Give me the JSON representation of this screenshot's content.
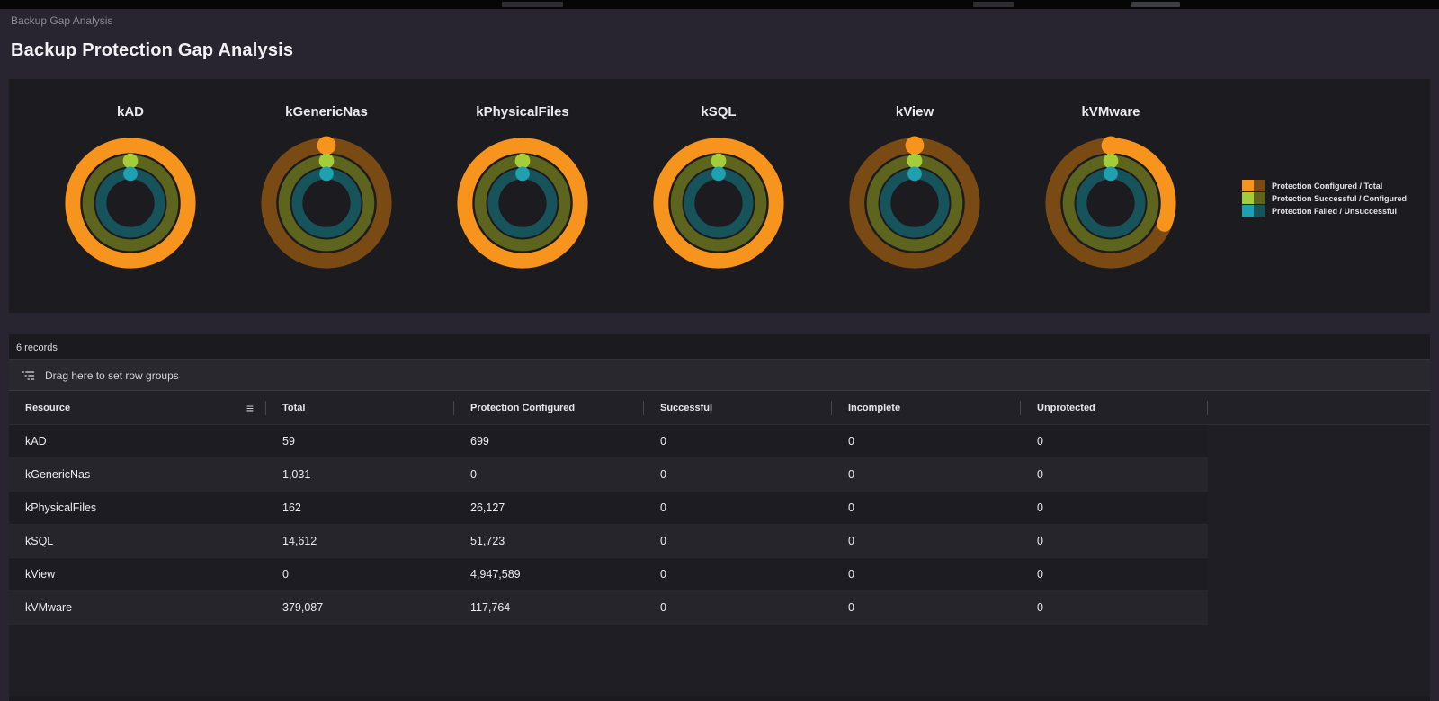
{
  "breadcrumb": "Backup Gap Analysis",
  "page_title": "Backup Protection Gap Analysis",
  "records_label": "6 records",
  "row_group_hint": "Drag here to set row groups",
  "colors": {
    "orange": "#F7941E",
    "brown": "#7A4A15",
    "green": "#A5CD39",
    "olive": "#5C641E",
    "teal": "#1FA0AE",
    "dark_teal": "#17535B",
    "panel_bg": "#1C1B20"
  },
  "legend": [
    {
      "label": "Protection Configured / Total",
      "bright": "#F7941E",
      "dark": "#7A4A15"
    },
    {
      "label": "Protection Successful / Configured",
      "bright": "#A5CD39",
      "dark": "#5C641E"
    },
    {
      "label": "Protection Failed / Unsuccessful",
      "bright": "#1FA0AE",
      "dark": "#17535B"
    }
  ],
  "chart_data": {
    "type": "donut-rings",
    "legend_position": "right",
    "rings_meaning": [
      "Protection Configured / Total",
      "Protection Successful / Configured",
      "Protection Failed / Unsuccessful"
    ],
    "charts": [
      {
        "title": "kAD",
        "total": 59,
        "protection_configured": 699,
        "successful": 0,
        "incomplete": 0,
        "unprotected": 0,
        "ring_fractions": [
          1,
          0,
          0
        ]
      },
      {
        "title": "kGenericNas",
        "total": 1031,
        "protection_configured": 0,
        "successful": 0,
        "incomplete": 0,
        "unprotected": 0,
        "ring_fractions": [
          0,
          0,
          0
        ]
      },
      {
        "title": "kPhysicalFiles",
        "total": 162,
        "protection_configured": 26127,
        "successful": 0,
        "incomplete": 0,
        "unprotected": 0,
        "ring_fractions": [
          1,
          0,
          0
        ]
      },
      {
        "title": "kSQL",
        "total": 14612,
        "protection_configured": 51723,
        "successful": 0,
        "incomplete": 0,
        "unprotected": 0,
        "ring_fractions": [
          1,
          0,
          0
        ]
      },
      {
        "title": "kView",
        "total": 0,
        "protection_configured": 4947589,
        "successful": 0,
        "incomplete": 0,
        "unprotected": 0,
        "ring_fractions": [
          0,
          0,
          0
        ]
      },
      {
        "title": "kVMware",
        "total": 379087,
        "protection_configured": 117764,
        "successful": 0,
        "incomplete": 0,
        "unprotected": 0,
        "ring_fractions": [
          0.31,
          0,
          0
        ]
      }
    ]
  },
  "table": {
    "columns": [
      "Resource",
      "Total",
      "Protection Configured",
      "Successful",
      "Incomplete",
      "Unprotected"
    ],
    "rows": [
      [
        "kAD",
        "59",
        "699",
        "0",
        "0",
        "0"
      ],
      [
        "kGenericNas",
        "1,031",
        "0",
        "0",
        "0",
        "0"
      ],
      [
        "kPhysicalFiles",
        "162",
        "26,127",
        "0",
        "0",
        "0"
      ],
      [
        "kSQL",
        "14,612",
        "51,723",
        "0",
        "0",
        "0"
      ],
      [
        "kView",
        "0",
        "4,947,589",
        "0",
        "0",
        "0"
      ],
      [
        "kVMware",
        "379,087",
        "117,764",
        "0",
        "0",
        "0"
      ]
    ]
  }
}
